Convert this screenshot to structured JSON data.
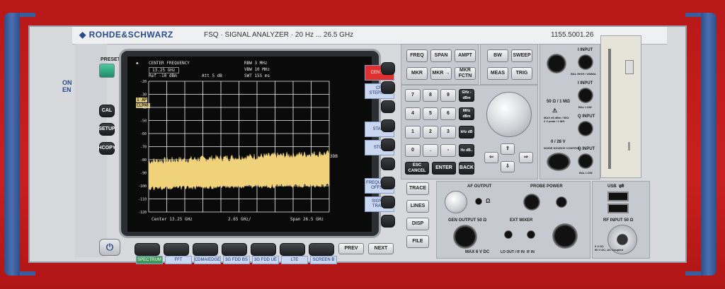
{
  "device": {
    "brand": "ROHDE&SCHWARZ",
    "model_line": "FSQ · SIGNAL ANALYZER · 20 Hz ... 26.5 GHz",
    "serial": "1155.5001.26"
  },
  "left_panel": {
    "preset": "PRESET",
    "cal": "CAL",
    "setup": "SETUP",
    "hcopy": "HCOPY",
    "edge_text": "ON\nEN"
  },
  "screen": {
    "header": {
      "marker_label": "CENTER FREQUENCY",
      "center_value": "13.25 GHz",
      "ref": "Ref -10 dBm",
      "att": "Att 5 dB",
      "rbw": "RBW 3 MHz",
      "vbw": "VBW 10 MHz",
      "swt": "SWT 155 ms"
    },
    "y_ticks": [
      "-20",
      "-30",
      "-40",
      "-50",
      "-60",
      "-70",
      "-80",
      "-90",
      "-100",
      "-110",
      "-120"
    ],
    "footer": {
      "center": "Center 13.25 GHz",
      "div": "2.65 GHz/",
      "span": "Span 26.5 GHz"
    },
    "side_labels": [
      "1 AP",
      "CLRWR"
    ],
    "right_marker": "3DB",
    "softkeys": [
      {
        "label": "CENTER",
        "active": true
      },
      {
        "label": "CF-\nSTEPSIZE"
      },
      {
        "label": "START"
      },
      {
        "label": "STOP"
      },
      {
        "label": "FREQUENCY\nOFFSET"
      },
      {
        "label": "SIGNAL\nTRACK"
      }
    ],
    "bottom_softkeys": [
      "SPECTRUM",
      "FFT",
      "CDMA/EDGE",
      "3G FDD BS",
      "3G FDD UE",
      "LTE",
      "SCREEN B"
    ]
  },
  "bottom_keys": {
    "prev": "PREV",
    "next": "NEXT"
  },
  "keypad": {
    "freq_row": [
      "FREQ",
      "SPAN",
      "AMPT"
    ],
    "mkr_row": [
      "MKR",
      "MKR →",
      "MKR FCTN"
    ],
    "bw_row": [
      "BW",
      "SWEEP"
    ],
    "meas_row": [
      "MEAS",
      "TRIG"
    ],
    "digits": [
      "7",
      "8",
      "9",
      "4",
      "5",
      "6",
      "1",
      "2",
      "3",
      "0",
      ".",
      "-"
    ],
    "units": [
      "GHz -dBm",
      "MHz dBm",
      "kHz dB",
      "Hz dB.."
    ],
    "esc": "ESC CANCEL",
    "enter": "ENTER",
    "back": "BACK"
  },
  "trace_keys": [
    "TRACE",
    "LINES",
    "DISP",
    "FILE"
  ],
  "connectors": {
    "i_input_1": "I INPUT",
    "i_input_2": "I INPUT",
    "q_input_1": "Q INPUT",
    "q_input_2": "Q INPUT",
    "bal_high": "BAL HIGH / UNBAL",
    "bal_low": "BAL LOW",
    "impedance": "50 Ω / 1 MΩ",
    "max_note": "MAX ±5 dBm / 50Ω\n2 V peak / 1 MΩ",
    "noise_source": "0 / 28 V",
    "noise_label": "NOISE SOURCE CONTROL",
    "af_output": "AF OUTPUT",
    "probe_power": "PROBE POWER",
    "usb": "USB",
    "gen_output": "GEN OUTPUT 50 Ω",
    "gen_max": "MAX 6 V DC",
    "ext_mixer": "EXT MIXER",
    "lo_out": "LO OUT / IF IN",
    "if_in": "IF IN",
    "rf_input": "RF INPUT 50 Ω",
    "rf_note": "0 V DC\n50 V DC, AC Coupled"
  },
  "colors": {
    "trace": "#f0d27a",
    "grid": "#f2f2f2",
    "screen_bg": "#0a0a0a",
    "softkey_active": "#e03030",
    "chassis_blue": "#3a5d9c"
  }
}
